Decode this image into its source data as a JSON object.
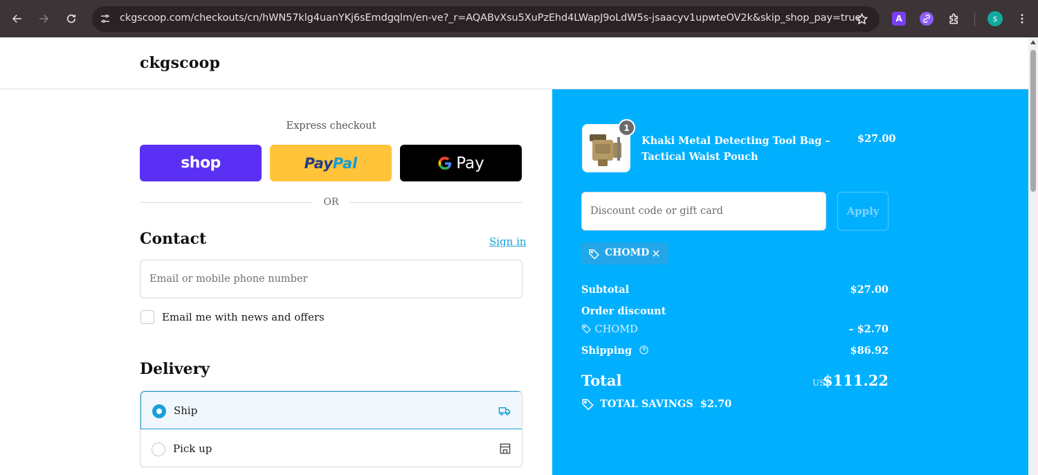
{
  "browser": {
    "url": "ckgscoop.com/checkouts/cn/hWN57klg4uanYKj6sEmdgqlm/en-ve?_r=AQABvXsu5XuPzEhd4LWapJ9oLdW5s-jsaacyv1upwteOV2k&skip_shop_pay=true",
    "ext_a_label": "A",
    "profile_initial": "s"
  },
  "store": {
    "name": "ckgscoop"
  },
  "express": {
    "label": "Express checkout",
    "shop_label": "shop",
    "paypal_label_a": "Pay",
    "paypal_label_b": "Pal",
    "gpay_g": "G",
    "gpay_label": "Pay",
    "or_label": "OR"
  },
  "contact": {
    "title": "Contact",
    "signin_label": "Sign in",
    "email_placeholder": "Email or mobile phone number",
    "newsletter_label": "Email me with news and offers"
  },
  "delivery": {
    "title": "Delivery",
    "options": [
      {
        "label": "Ship",
        "selected": true
      },
      {
        "label": "Pick up",
        "selected": false
      }
    ]
  },
  "summary": {
    "item": {
      "name": "Khaki Metal Detecting Tool Bag – Tactical Waist Pouch",
      "quantity": "1",
      "price": "$27.00"
    },
    "discount_placeholder": "Discount code or gift card",
    "apply_label": "Apply",
    "applied_code": "CHOMD",
    "subtotal_label": "Subtotal",
    "subtotal_value": "$27.00",
    "order_discount_label": "Order discount",
    "discount_code": "CHOMD",
    "discount_value": "– $2.70",
    "shipping_label": "Shipping",
    "shipping_value": "$86.92",
    "total_label": "Total",
    "total_currency": "USD",
    "total_value": "$111.22",
    "savings_label": "TOTAL SAVINGS",
    "savings_value": "$2.70"
  },
  "colors": {
    "accent": "#1a9fd9",
    "summary_bg": "#00b0ff",
    "shop_purple": "#5a31f4",
    "paypal_yellow": "#ffc439"
  }
}
